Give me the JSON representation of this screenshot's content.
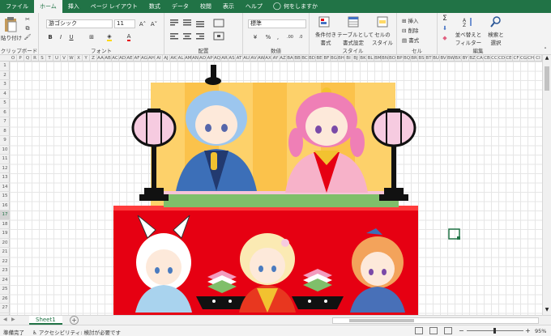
{
  "tabs": [
    "ファイル",
    "ホーム",
    "挿入",
    "ページ レイアウト",
    "数式",
    "データ",
    "校閲",
    "表示",
    "ヘルプ"
  ],
  "active_tab": "ホーム",
  "tell_me": "何をしますか",
  "ribbon": {
    "paste": "貼り付け",
    "font_name": "游ゴシック",
    "font_size": "11",
    "number_format": "標準",
    "conditional": "条件付き\n書式",
    "table_format": "テーブルとして\n書式設定",
    "cell_styles": "セルの\nスタイル",
    "insert": "挿入",
    "delete": "削除",
    "format": "書式",
    "sort_filter": "並べ替えと\nフィルター",
    "find_select": "検索と\n選択",
    "groups": [
      "クリップボード",
      "フォント",
      "配置",
      "数値",
      "スタイル",
      "セル",
      "編集"
    ],
    "bold": "B",
    "italic": "I",
    "underline": "U",
    "sigma": "Σ",
    "percent": "%",
    "comma": ","
  },
  "columns": [
    "O",
    "P",
    "Q",
    "R",
    "S",
    "T",
    "U",
    "V",
    "W",
    "X",
    "Y",
    "Z",
    "AA",
    "AB",
    "AC",
    "AD",
    "AE",
    "AF",
    "AG",
    "AH",
    "AI",
    "AJ",
    "AK",
    "AL",
    "AM",
    "AN",
    "AO",
    "AP",
    "AQ",
    "AR",
    "AS",
    "AT",
    "AU",
    "AV",
    "AW",
    "AX",
    "AY",
    "AZ",
    "BA",
    "BB",
    "BC",
    "BD",
    "BE",
    "BF",
    "BG",
    "BH",
    "BI",
    "BJ",
    "BK",
    "BL",
    "BM",
    "BN",
    "BO",
    "BP",
    "BQ",
    "BR",
    "BS",
    "BT",
    "BU",
    "BV",
    "BW",
    "BX",
    "BY",
    "BZ",
    "CA",
    "CB",
    "CC",
    "CD",
    "CE",
    "CF",
    "CG",
    "CH",
    "CI",
    "CJ",
    "CK",
    "CL",
    "CM",
    "CN",
    "CO",
    "CP",
    "CQ",
    "CR",
    "CS",
    "CT",
    "CU",
    "CV",
    "CW",
    "CX",
    "CY",
    "CZ",
    "DA",
    "DB",
    "DC",
    "DD",
    "DE",
    "DF",
    "DG",
    "DH",
    "DI",
    "DJ",
    "DK",
    "DL",
    "DM",
    "DN",
    "DO",
    "DP",
    "DQ"
  ],
  "rows": [
    "1",
    "2",
    "3",
    "4",
    "5",
    "6",
    "7",
    "8",
    "9",
    "10",
    "11",
    "12",
    "13",
    "14",
    "15",
    "16",
    "17",
    "18",
    "19",
    "20",
    "21",
    "22",
    "23",
    "24",
    "25",
    "26",
    "27"
  ],
  "selected_row": "17",
  "sheet_tab": "Sheet1",
  "status": {
    "ready": "準備完了",
    "accessibility": "アクセシビリティ: 検討が必要です",
    "zoom": "95%"
  },
  "colors": {
    "excel_green": "#217346",
    "red": "#e60012",
    "screen": "#fbc843"
  }
}
